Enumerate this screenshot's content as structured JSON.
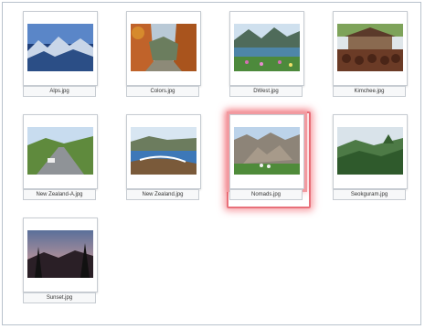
{
  "files": [
    {
      "name": "Alps.jpg",
      "icon": "alps-thumbnail"
    },
    {
      "name": "Colors.jpg",
      "icon": "colors-thumbnail"
    },
    {
      "name": "DWest.jpg",
      "icon": "dwest-thumbnail"
    },
    {
      "name": "Kimchee.jpg",
      "icon": "kimchee-thumbnail"
    },
    {
      "name": "New Zealand-A.jpg",
      "icon": "new-zealand-a-thumbnail"
    },
    {
      "name": "New Zealand.jpg",
      "icon": "new-zealand-thumbnail"
    },
    {
      "name": "Nomads.jpg",
      "icon": "nomads-thumbnail"
    },
    {
      "name": "Seokguram.jpg",
      "icon": "seokguram-thumbnail"
    },
    {
      "name": "Sunset.jpg",
      "icon": "sunset-thumbnail"
    }
  ],
  "selected_file": "Nomads.jpg",
  "colors": {
    "selection_border": "#e8707a",
    "background": "#ffffff"
  }
}
